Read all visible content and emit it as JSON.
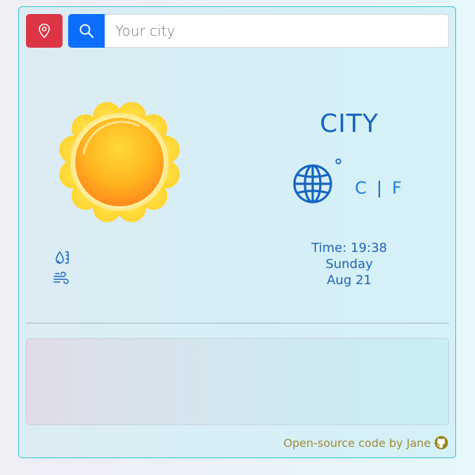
{
  "search": {
    "placeholder": "Your city",
    "value": ""
  },
  "weather": {
    "icon": "sun-icon",
    "city": "CITY",
    "degree_symbol": "°",
    "unit_celsius": "C",
    "unit_separator": "|",
    "unit_fahrenheit": "F",
    "time": "Time: 19:38",
    "day": "Sunday",
    "date": "Aug 21"
  },
  "footer": {
    "text": "Open-source code by Jane"
  },
  "colors": {
    "location_button": "#dc3545",
    "search_button": "#0d6efd",
    "accent_blue": "#1565c0",
    "footer_text": "#a18a3a"
  }
}
